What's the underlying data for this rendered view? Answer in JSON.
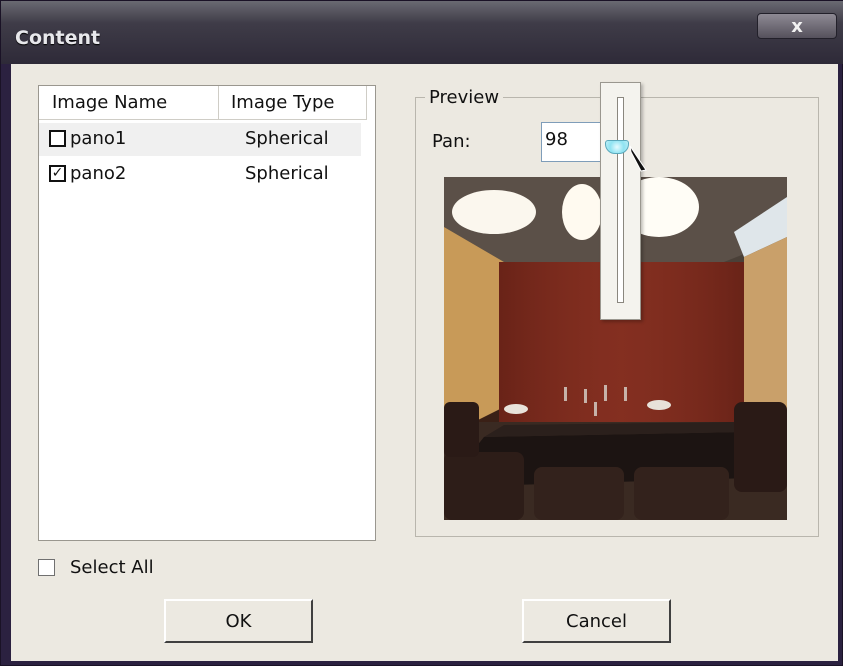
{
  "window": {
    "title": "Content",
    "close_label": "x"
  },
  "listview": {
    "columns": [
      "Image Name",
      "Image Type"
    ],
    "rows": [
      {
        "name": "pano1",
        "type": "Spherical",
        "checked": false
      },
      {
        "name": "pano2",
        "type": "Spherical",
        "checked": true
      }
    ]
  },
  "select_all": {
    "label": "Select All",
    "checked": false
  },
  "buttons": {
    "ok": "OK",
    "cancel": "Cancel"
  },
  "preview": {
    "group_title": "Preview",
    "pan_label": "Pan:",
    "pan_value": "98"
  },
  "icons": {
    "check": "✓",
    "cursor": "arrow-cursor-icon"
  }
}
